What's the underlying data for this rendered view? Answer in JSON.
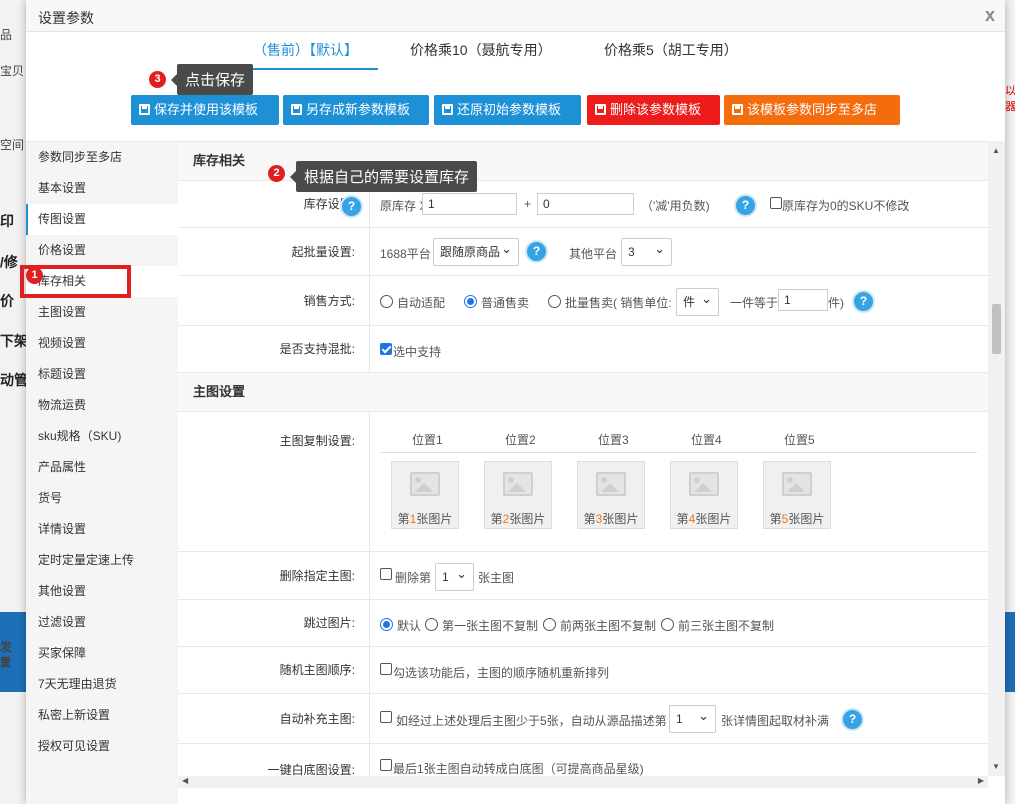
{
  "background": {
    "left_fragments": [
      "品",
      "宝贝",
      "空间",
      "印",
      "i/修",
      "价",
      "下架",
      "动管理",
      "发",
      "置"
    ],
    "right_fragments": [
      "以",
      "器"
    ]
  },
  "modal": {
    "title": "设置参数",
    "close": "x"
  },
  "tabs": [
    {
      "label": "（售前）【默认】",
      "active": true
    },
    {
      "label": "价格乘10（聂航专用）",
      "active": false
    },
    {
      "label": "价格乘5（胡工专用）",
      "active": false
    }
  ],
  "annotations": {
    "step1": {
      "num": "1"
    },
    "step2": {
      "num": "2",
      "text": "根据自己的需要设置库存"
    },
    "step3": {
      "num": "3",
      "text": "点击保存"
    }
  },
  "buttons": [
    {
      "label": "保存并使用该模板",
      "color": "#1e90d6"
    },
    {
      "label": "另存成新参数模板",
      "color": "#1e90d6"
    },
    {
      "label": "还原初始参数模板",
      "color": "#1e90d6"
    },
    {
      "label": "删除该参数模板",
      "color": "#ee1b1b"
    },
    {
      "label": "该模板参数同步至多店",
      "color": "#f36c0e"
    }
  ],
  "sidebar": {
    "items": [
      {
        "label": "参数同步至多店"
      },
      {
        "label": "基本设置"
      },
      {
        "label": "传图设置",
        "active": true
      },
      {
        "label": "价格设置"
      },
      {
        "label": "库存相关",
        "current": true
      },
      {
        "label": "主图设置"
      },
      {
        "label": "视频设置"
      },
      {
        "label": "标题设置"
      },
      {
        "label": "物流运费"
      },
      {
        "label": "sku规格（SKU)"
      },
      {
        "label": "产品属性"
      },
      {
        "label": "货号"
      },
      {
        "label": "详情设置"
      },
      {
        "label": "定时定量定速上传"
      },
      {
        "label": "其他设置"
      },
      {
        "label": "过滤设置"
      },
      {
        "label": "买家保障"
      },
      {
        "label": "7天无理由退货"
      },
      {
        "label": "私密上新设置"
      },
      {
        "label": "授权可见设置"
      }
    ]
  },
  "inventory": {
    "section_title": "库存相关",
    "stock": {
      "label": "库存设置:",
      "prefix": "原库存 X",
      "multiplier": "1",
      "plus": "+",
      "offset": "0",
      "note": "（'减'用负数)",
      "skip_zero_label": "原库存为0的SKU不修改",
      "skip_zero_checked": false
    },
    "batch": {
      "label": "起批量设置:",
      "platform_1688": "1688平台",
      "platform_1688_value": "跟随原商品",
      "other_platform": "其他平台",
      "other_value": "3"
    },
    "sale_mode": {
      "label": "销售方式:",
      "options": [
        "自动适配",
        "普通售卖",
        "批量售卖( 销售单位:"
      ],
      "selected": 1,
      "unit_value": "件",
      "equals_text": "一件等于",
      "equals_value": "1",
      "unit_suffix": "件)"
    },
    "mixed": {
      "label": "是否支持混批:",
      "option": "选中支持",
      "checked": true
    }
  },
  "main_image": {
    "section_title": "主图设置",
    "copy": {
      "label": "主图复制设置:",
      "positions": [
        "位置1",
        "位置2",
        "位置3",
        "位置4",
        "位置5"
      ],
      "thumbs": [
        {
          "pre": "第",
          "num": "1",
          "post": "张图片"
        },
        {
          "pre": "第",
          "num": "2",
          "post": "张图片"
        },
        {
          "pre": "第",
          "num": "3",
          "post": "张图片"
        },
        {
          "pre": "第",
          "num": "4",
          "post": "张图片"
        },
        {
          "pre": "第",
          "num": "5",
          "post": "张图片"
        }
      ]
    },
    "delete": {
      "label": "删除指定主图:",
      "pre": "删除第",
      "value": "1",
      "post": "张主图",
      "checked": false
    },
    "skip": {
      "label": "跳过图片:",
      "options": [
        "默认",
        "第一张主图不复制",
        "前两张主图不复制",
        "前三张主图不复制"
      ],
      "selected": 0
    },
    "random": {
      "label": "随机主图顺序:",
      "text": "勾选该功能后，主图的顺序随机重新排列",
      "checked": false
    },
    "autofill": {
      "label": "自动补充主图:",
      "pre": "如经过上述处理后主图少于5张，自动从源品描述第",
      "value": "1",
      "post": "张详情图起取材补满",
      "checked": false
    },
    "white_bg": {
      "label": "一键白底图设置:",
      "text": "最后1张主图自动转成白底图（可提高商品星级)",
      "checked": false
    }
  }
}
